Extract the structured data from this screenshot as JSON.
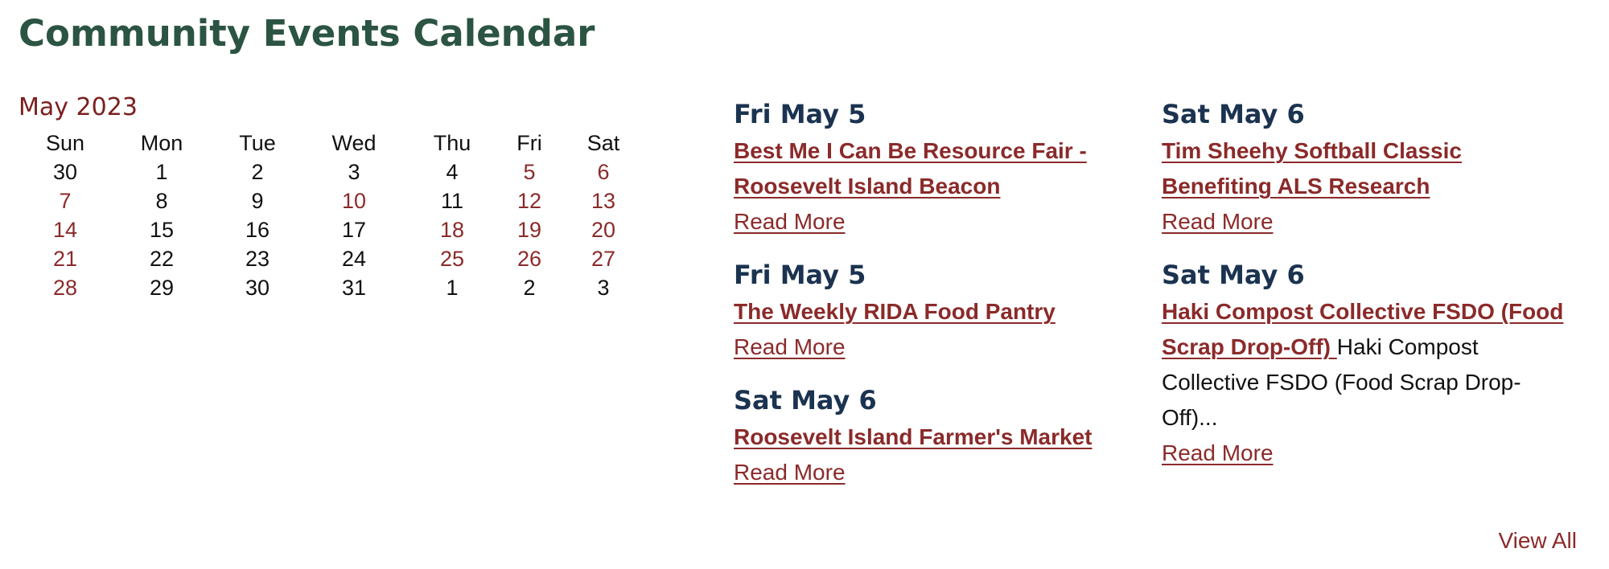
{
  "page": {
    "title": "Community Events Calendar"
  },
  "calendar": {
    "month_label": "May 2023",
    "weekdays": [
      "Sun",
      "Mon",
      "Tue",
      "Wed",
      "Thu",
      "Fri",
      "Sat"
    ],
    "weeks": [
      [
        {
          "day": "30",
          "event": false
        },
        {
          "day": "1",
          "event": false
        },
        {
          "day": "2",
          "event": false
        },
        {
          "day": "3",
          "event": false
        },
        {
          "day": "4",
          "event": false
        },
        {
          "day": "5",
          "event": true
        },
        {
          "day": "6",
          "event": true
        }
      ],
      [
        {
          "day": "7",
          "event": true
        },
        {
          "day": "8",
          "event": false
        },
        {
          "day": "9",
          "event": false
        },
        {
          "day": "10",
          "event": true
        },
        {
          "day": "11",
          "event": false
        },
        {
          "day": "12",
          "event": true
        },
        {
          "day": "13",
          "event": true
        }
      ],
      [
        {
          "day": "14",
          "event": true
        },
        {
          "day": "15",
          "event": false
        },
        {
          "day": "16",
          "event": false
        },
        {
          "day": "17",
          "event": false
        },
        {
          "day": "18",
          "event": true
        },
        {
          "day": "19",
          "event": true
        },
        {
          "day": "20",
          "event": true
        }
      ],
      [
        {
          "day": "21",
          "event": true
        },
        {
          "day": "22",
          "event": false
        },
        {
          "day": "23",
          "event": false
        },
        {
          "day": "24",
          "event": false
        },
        {
          "day": "25",
          "event": true
        },
        {
          "day": "26",
          "event": true
        },
        {
          "day": "27",
          "event": true
        }
      ],
      [
        {
          "day": "28",
          "event": true
        },
        {
          "day": "29",
          "event": false
        },
        {
          "day": "30",
          "event": false
        },
        {
          "day": "31",
          "event": false
        },
        {
          "day": "1",
          "event": false
        },
        {
          "day": "2",
          "event": false
        },
        {
          "day": "3",
          "event": false
        }
      ]
    ]
  },
  "events_left": [
    {
      "date": "Fri May 5",
      "title": "Best Me I Can Be Resource Fair - Roosevelt Island Beacon",
      "excerpt": "",
      "read_more": "Read More"
    },
    {
      "date": "Fri May 5",
      "title": "The Weekly RIDA Food Pantry",
      "excerpt": "",
      "read_more": "Read More"
    },
    {
      "date": "Sat May 6",
      "title": "Roosevelt Island Farmer's Market",
      "excerpt": "",
      "read_more": "Read More"
    }
  ],
  "events_right": [
    {
      "date": "Sat May 6",
      "title": "Tim Sheehy Softball Classic Benefiting ALS Research",
      "excerpt": "",
      "read_more": "Read More"
    },
    {
      "date": "Sat May 6",
      "title": "Haki Compost Collective FSDO (Food Scrap Drop-Off) ",
      "excerpt": "Haki Compost Collective FSDO (Food Scrap Drop-Off)...",
      "read_more": "Read More"
    }
  ],
  "footer": {
    "view_all": "View All"
  },
  "colors": {
    "title_green": "#2b5442",
    "accent_red": "#8b2a2a",
    "month_red": "#7a1f1f",
    "date_navy": "#1b3350"
  }
}
